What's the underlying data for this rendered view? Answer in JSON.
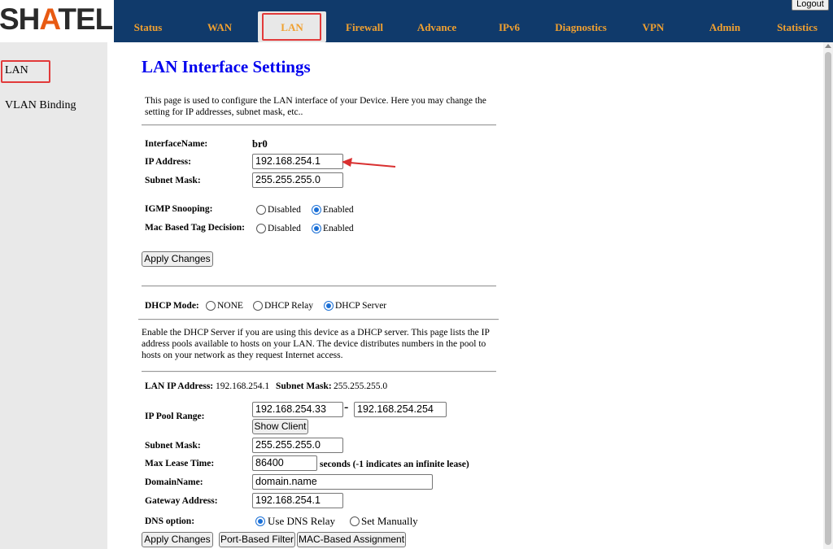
{
  "brand": {
    "prefix": "SH",
    "accent": "A",
    "suffix": "TEL"
  },
  "topnav": {
    "tabs": [
      "Status",
      "WAN",
      "LAN",
      "Firewall",
      "Advance",
      "IPv6",
      "Diagnostics",
      "VPN",
      "Admin",
      "Statistics"
    ],
    "active": "LAN"
  },
  "logout_label": "Logout",
  "sidebar": {
    "items": [
      "LAN",
      "VLAN Binding"
    ]
  },
  "page_title": "LAN Interface Settings",
  "intro": "This page is used to configure the LAN interface of your Device. Here you may change the setting for IP addresses, subnet mask, etc..",
  "interface": {
    "name_label": "InterfaceName:",
    "name_value": "br0",
    "ip_label": "IP Address:",
    "ip_value": "192.168.254.1",
    "mask_label": "Subnet Mask:",
    "mask_value": "255.255.255.0",
    "igmp_label": "IGMP Snooping:",
    "mac_label": "Mac Based Tag Decision:",
    "disabled": "Disabled",
    "enabled": "Enabled",
    "igmp_selected": "Enabled",
    "mac_selected": "Enabled",
    "apply": "Apply Changes"
  },
  "dhcp": {
    "mode_label": "DHCP Mode:",
    "modes": [
      "NONE",
      "DHCP Relay",
      "DHCP Server"
    ],
    "mode_selected": "DHCP Server",
    "description": "Enable the DHCP Server if you are using this device as a DHCP server. This page lists the IP address pools available to hosts on your LAN. The device distributes numbers in the pool to hosts on your network as they request Internet access.",
    "lan_ip_label": "LAN IP Address:",
    "lan_ip_value": "192.168.254.1",
    "lan_mask_label": "Subnet Mask:",
    "lan_mask_value": "255.255.255.0",
    "pool_label": "IP Pool Range:",
    "pool_start": "192.168.254.33",
    "pool_sep": "-",
    "pool_end": "192.168.254.254",
    "show_client": "Show Client",
    "mask_label": "Subnet Mask:",
    "mask_value": "255.255.255.0",
    "lease_label": "Max Lease Time:",
    "lease_value": "86400",
    "lease_note": "seconds (-1 indicates an infinite lease)",
    "domain_label": "DomainName:",
    "domain_value": "domain.name",
    "gateway_label": "Gateway Address:",
    "gateway_value": "192.168.254.1",
    "dns_label": "DNS option:",
    "dns_relay": "Use DNS Relay",
    "dns_manual": "Set Manually",
    "dns_selected": "Use DNS Relay",
    "apply": "Apply Changes",
    "port_filter": "Port-Based Filter",
    "mac_assign": "MAC-Based Assignment"
  },
  "colors": {
    "nav_bg": "#103a6b",
    "nav_text": "#f0a030",
    "title": "#0000ee",
    "highlight": "#e23a3a",
    "arrow": "#d93030",
    "radio": "#1a6fd6"
  }
}
